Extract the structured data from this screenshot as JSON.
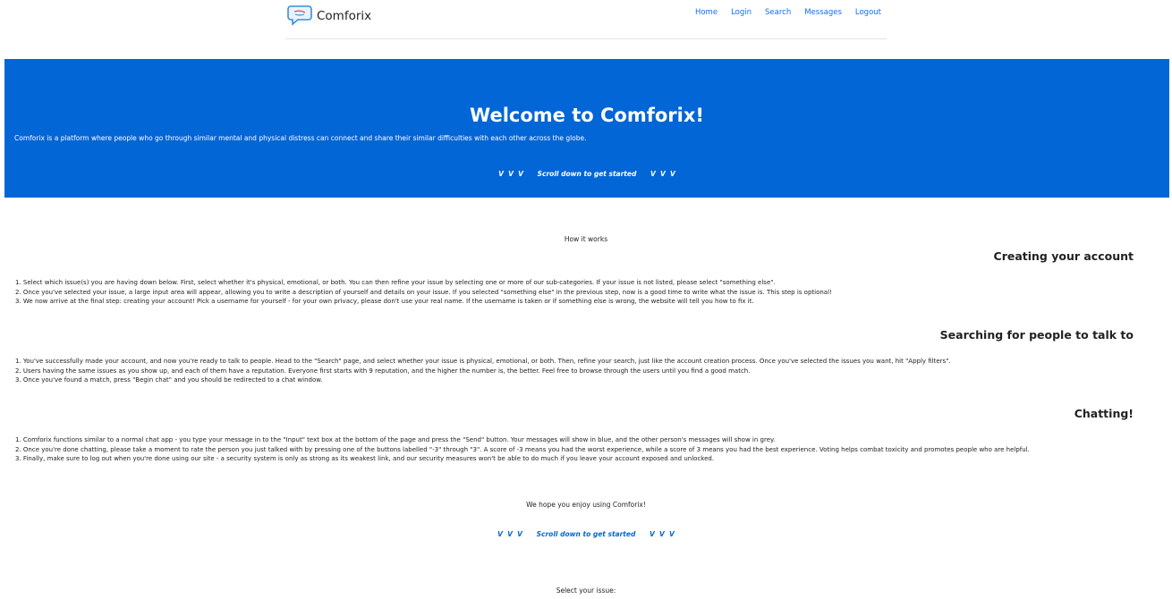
{
  "nav": {
    "brand": "Comforix",
    "links": [
      "Home",
      "Login",
      "Search",
      "Messages",
      "Logout"
    ]
  },
  "hero": {
    "title": "Welcome to Comforix!",
    "description": "Comforix is a platform where people who go through similar mental and physical distress can connect and share their similar difficulties with each other across the globe.",
    "scroll_hint": "V  V  V      Scroll down to get started      V  V  V"
  },
  "content": {
    "how_it_works": "How it works",
    "sections": [
      {
        "title": "Creating your account",
        "steps": [
          "1. Select which issue(s) you are having down below. First, select whether it's physical, emotional, or both. You can then refine your issue by selecting one or more of our sub-categories. If your issue is not listed, please select \"something else\".",
          "2. Once you've selected your issue, a large input area will appear, allowing you to write a description of yourself and details on your issue. If you selected \"something else\" in the previous step, now is a good time to write what the issue is. This step is optional!",
          "3. We now arrive at the final step: creating your account! Pick a username for yourself - for your own privacy, please don't use your real name. If the username is taken or if something else is wrong, the website will tell you how to fix it."
        ]
      },
      {
        "title": "Searching for people to talk to",
        "steps": [
          "1. You've successfully made your account, and now you're ready to talk to people. Head to the \"Search\" page, and select whether your issue is physical, emotional, or both. Then, refine your search, just like the account creation process. Once you've selected the issues you want, hit \"Apply filters\".",
          "2. Users having the same issues as you show up, and each of them have a reputation. Everyone first starts with 9 reputation, and the higher the number is, the better. Feel free to browse through the users until you find a good match.",
          "3. Once you've found a match, press \"Begin chat\" and you should be redirected to a chat window."
        ]
      },
      {
        "title": "Chatting!",
        "steps": [
          "1. Comforix functions similar to a normal chat app - you type your message in to the \"Input\" text box at the bottom of the page and press the \"Send\" button. Your messages will show in blue, and the other person's messages will show in grey.",
          "2. Once you're done chatting, please take a moment to rate the person you just talked with by pressing one of the buttons labelled \"-3\" through \"3\". A score of -3 means you had the worst experience, while a score of 3 means you had the best experience. Voting helps combat toxicity and promotes people who are helpful.",
          "3. Finally, make sure to log out when you're done using our site - a security system is only as strong as its weakest link, and our security measures won't be able to do much if you leave your account exposed and unlocked."
        ]
      }
    ],
    "closing": "We hope you enjoy using Comforix!",
    "scroll_hint": "V  V  V      Scroll down to get started      V  V  V",
    "select_issue": "Select your issue:"
  },
  "colors": {
    "hero_bg": "#0366d6",
    "link": "#0d6efd"
  },
  "icons": {
    "logo": "chat-bubble-logo-icon"
  }
}
